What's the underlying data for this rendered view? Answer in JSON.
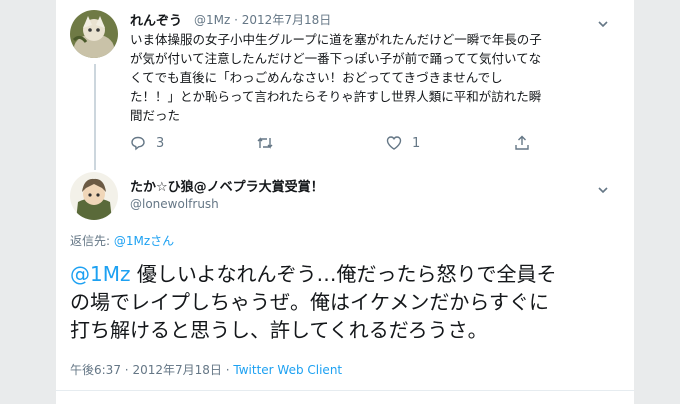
{
  "tweet1": {
    "display_name": "れんぞう",
    "handle": "@1Mz",
    "separator": "·",
    "date": "2012年7月18日",
    "text": "いま体操服の女子小中生グループに道を塞がれたんだけど一瞬で年長の子\nが気が付いて注意したんだけど一番下っぽい子が前で踊ってて気付いてな\nくてでも直後に「わっごめんなさい！おどっててきづきませんでし\nた！！」とか恥らって言われたらそりゃ許すし世界人類に平和が訪れた瞬\n間だった",
    "reply_count": "3",
    "retweet_count": "",
    "like_count": "1"
  },
  "tweet2": {
    "display_name": "たか☆ひ狼@ノベプラ大賞受賞！",
    "handle": "@lonewolfrush",
    "reply_to_label": "返信先:",
    "reply_to_handle": "@1Mzさん",
    "mention": "@1Mz",
    "text": " 優しいよなれんぞう…俺だったら怒りで全員そ\nの場でレイプしちゃうぜ。俺はイケメンだからすぐに\n打ち解けると思うし、許してくれるだろうさ。",
    "time": "午後6:37",
    "date": "2012年7月18日",
    "client": "Twitter Web Client"
  },
  "colors": {
    "link": "#1da1f2",
    "secondary": "#657786",
    "text": "#14171a"
  },
  "icons": [
    "chevron-down-icon",
    "reply-icon",
    "retweet-icon",
    "like-icon",
    "share-icon"
  ]
}
